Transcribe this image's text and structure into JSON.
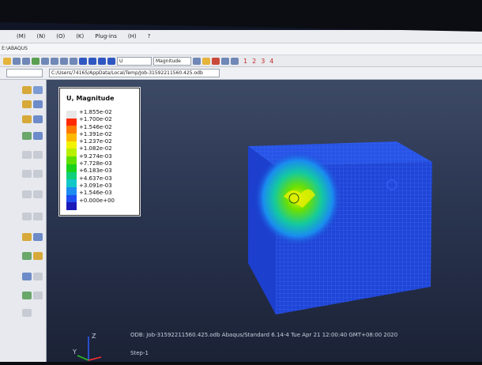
{
  "menubar": {
    "items": [
      "",
      "(M)",
      "(N)",
      "(O)",
      "(K)",
      "Plug-ins",
      "(H)",
      "?"
    ]
  },
  "path": "E:\\ABAQUS",
  "toolbar": {
    "step_combo": "U",
    "magnitude_combo": "Magnitude",
    "frame_numbers": [
      "1",
      "2",
      "3",
      "4"
    ]
  },
  "toolbar2": {
    "module_label": "",
    "model_combo": "",
    "odb_label": "",
    "odb_path": "C:/Users/74165/AppData/Local/Temp/Job-31592211560.425.odb"
  },
  "legend": {
    "title": "U, Magnitude",
    "values": [
      "+1.855e-02",
      "+1.700e-02",
      "+1.546e-02",
      "+1.391e-02",
      "+1.237e-02",
      "+1.082e-02",
      "+9.274e-03",
      "+7.728e-03",
      "+6.183e-03",
      "+4.637e-03",
      "+3.091e-03",
      "+1.546e-03",
      "+0.000e+00"
    ],
    "colors": [
      "#e8e8e8",
      "#ff2a00",
      "#ff7a00",
      "#ffb800",
      "#f2f200",
      "#b8f000",
      "#5fe000",
      "#1ad21a",
      "#10d07a",
      "#10c8c8",
      "#1c8cf0",
      "#1e4ef0",
      "#1a1ab8"
    ]
  },
  "footer": {
    "line1": "ODB: Job-31592211560.425.odb     Abaqus/Standard 6.14-4     Tue Apr 21 12:00:40 GMT+08:00 2020",
    "line2": "Step-1"
  },
  "triad": {
    "y_label": "Z",
    "x_label": "Y"
  },
  "colors": {
    "model_blue": "#1f45d6",
    "mesh_line": "#3a64ff"
  }
}
